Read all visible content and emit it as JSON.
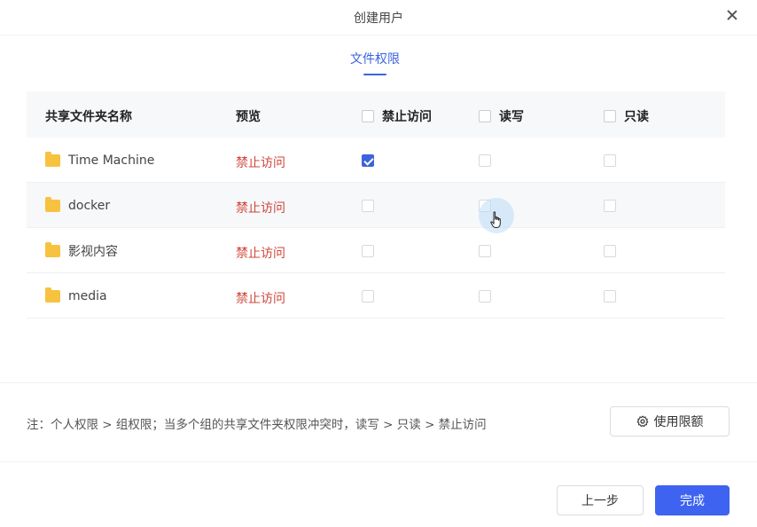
{
  "dialog": {
    "title": "创建用户"
  },
  "tabs": [
    {
      "label": "文件权限",
      "active": true
    }
  ],
  "table": {
    "headers": {
      "name": "共享文件夹名称",
      "preview": "预览",
      "deny": "禁止访问",
      "readwrite": "读写",
      "readonly": "只读"
    },
    "rows": [
      {
        "name": "Time Machine",
        "preview": "禁止访问",
        "deny": true,
        "readwrite": false,
        "readonly": false
      },
      {
        "name": "docker",
        "preview": "禁止访问",
        "deny": false,
        "readwrite": false,
        "readonly": false
      },
      {
        "name": "影视内容",
        "preview": "禁止访问",
        "deny": false,
        "readwrite": false,
        "readonly": false
      },
      {
        "name": "media",
        "preview": "禁止访问",
        "deny": false,
        "readwrite": false,
        "readonly": false
      }
    ]
  },
  "note": "注：个人权限 > 组权限；当多个组的共享文件夹权限冲突时，读写 > 只读 > 禁止访问",
  "quota_button": {
    "label": "使用限额",
    "icon": "gear-icon"
  },
  "footer": {
    "prev_label": "上一步",
    "done_label": "完成"
  },
  "colors": {
    "accent": "#3d63dd",
    "danger_text": "#d0453a",
    "folder": "#f7c23f"
  }
}
